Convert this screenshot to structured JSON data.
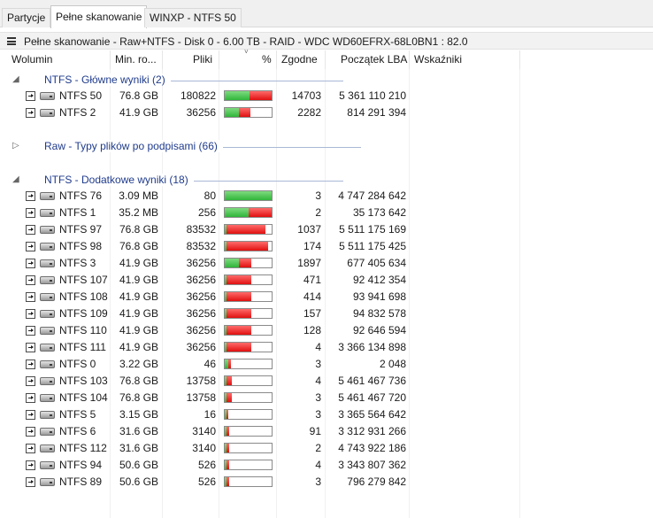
{
  "tabs": [
    {
      "label": "Partycje",
      "active": false
    },
    {
      "label": "Pełne skanowanie",
      "active": true
    },
    {
      "label": "WINXP - NTFS 50",
      "active": false
    }
  ],
  "title": "Pełne skanowanie - Raw+NTFS - Disk 0 - 6.00 TB - RAID - WDC WD60EFRX-68L0BN1 : 82.0",
  "columns": {
    "volume": "Wolumin",
    "min_size": "Min. ro...",
    "files": "Pliki",
    "percent": "%",
    "matching": "Zgodne",
    "lba_start": "Początek LBA",
    "indicators": "Wskaźniki"
  },
  "colors": {
    "good": "#2fb53a",
    "bad": "#e01010",
    "group_text": "#1f3b8c"
  },
  "groups": [
    {
      "label": "NTFS - Główne wyniki (2)",
      "expanded": true,
      "rows": [
        {
          "name": "NTFS 50",
          "size": "76.8 GB",
          "files": "180822",
          "good": 0.52,
          "bad": 0.48,
          "matching": "14703",
          "lba": "5 361 110 210"
        },
        {
          "name": "NTFS 2",
          "size": "41.9 GB",
          "files": "36256",
          "good": 0.3,
          "bad": 0.24,
          "matching": "2282",
          "lba": "814 291 394"
        }
      ]
    },
    {
      "label": "Raw - Typy plików po podpisami (66)",
      "expanded": false,
      "rows": []
    },
    {
      "label": "NTFS - Dodatkowe wyniki (18)",
      "expanded": true,
      "rows": [
        {
          "name": "NTFS 76",
          "size": "3.09 MB",
          "files": "80",
          "good": 1.0,
          "bad": 0.0,
          "matching": "3",
          "lba": "4 747 284 642"
        },
        {
          "name": "NTFS 1",
          "size": "35.2 MB",
          "files": "256",
          "good": 0.5,
          "bad": 0.5,
          "matching": "2",
          "lba": "35 173 642"
        },
        {
          "name": "NTFS 97",
          "size": "76.8 GB",
          "files": "83532",
          "good": 0.04,
          "bad": 0.83,
          "matching": "1037",
          "lba": "5 511 175 169"
        },
        {
          "name": "NTFS 98",
          "size": "76.8 GB",
          "files": "83532",
          "good": 0.04,
          "bad": 0.89,
          "matching": "174",
          "lba": "5 511 175 425"
        },
        {
          "name": "NTFS 3",
          "size": "41.9 GB",
          "files": "36256",
          "good": 0.3,
          "bad": 0.26,
          "matching": "1897",
          "lba": "677 405 634"
        },
        {
          "name": "NTFS 107",
          "size": "41.9 GB",
          "files": "36256",
          "good": 0.04,
          "bad": 0.52,
          "matching": "471",
          "lba": "92 412 354"
        },
        {
          "name": "NTFS 108",
          "size": "41.9 GB",
          "files": "36256",
          "good": 0.04,
          "bad": 0.52,
          "matching": "414",
          "lba": "93 941 698"
        },
        {
          "name": "NTFS 109",
          "size": "41.9 GB",
          "files": "36256",
          "good": 0.04,
          "bad": 0.52,
          "matching": "157",
          "lba": "94 832 578"
        },
        {
          "name": "NTFS 110",
          "size": "41.9 GB",
          "files": "36256",
          "good": 0.04,
          "bad": 0.52,
          "matching": "128",
          "lba": "92 646 594"
        },
        {
          "name": "NTFS 111",
          "size": "41.9 GB",
          "files": "36256",
          "good": 0.04,
          "bad": 0.52,
          "matching": "4",
          "lba": "3 366 134 898"
        },
        {
          "name": "NTFS 0",
          "size": "3.22 GB",
          "files": "46",
          "good": 0.08,
          "bad": 0.06,
          "matching": "3",
          "lba": "2 048"
        },
        {
          "name": "NTFS 103",
          "size": "76.8 GB",
          "files": "13758",
          "good": 0.04,
          "bad": 0.11,
          "matching": "4",
          "lba": "5 461 467 736"
        },
        {
          "name": "NTFS 104",
          "size": "76.8 GB",
          "files": "13758",
          "good": 0.04,
          "bad": 0.11,
          "matching": "3",
          "lba": "5 461 467 720"
        },
        {
          "name": "NTFS 5",
          "size": "3.15 GB",
          "files": "16",
          "good": 0.03,
          "bad": 0.05,
          "matching": "3",
          "lba": "3 365 564 642"
        },
        {
          "name": "NTFS 6",
          "size": "31.6 GB",
          "files": "3140",
          "good": 0.04,
          "bad": 0.06,
          "matching": "91",
          "lba": "3 312 931 266"
        },
        {
          "name": "NTFS 112",
          "size": "31.6 GB",
          "files": "3140",
          "good": 0.03,
          "bad": 0.06,
          "matching": "2",
          "lba": "4 743 922 186"
        },
        {
          "name": "NTFS 94",
          "size": "50.6 GB",
          "files": "526",
          "good": 0.03,
          "bad": 0.06,
          "matching": "4",
          "lba": "3 343 807 362"
        },
        {
          "name": "NTFS 89",
          "size": "50.6 GB",
          "files": "526",
          "good": 0.03,
          "bad": 0.06,
          "matching": "3",
          "lba": "796 279 842"
        }
      ]
    }
  ]
}
